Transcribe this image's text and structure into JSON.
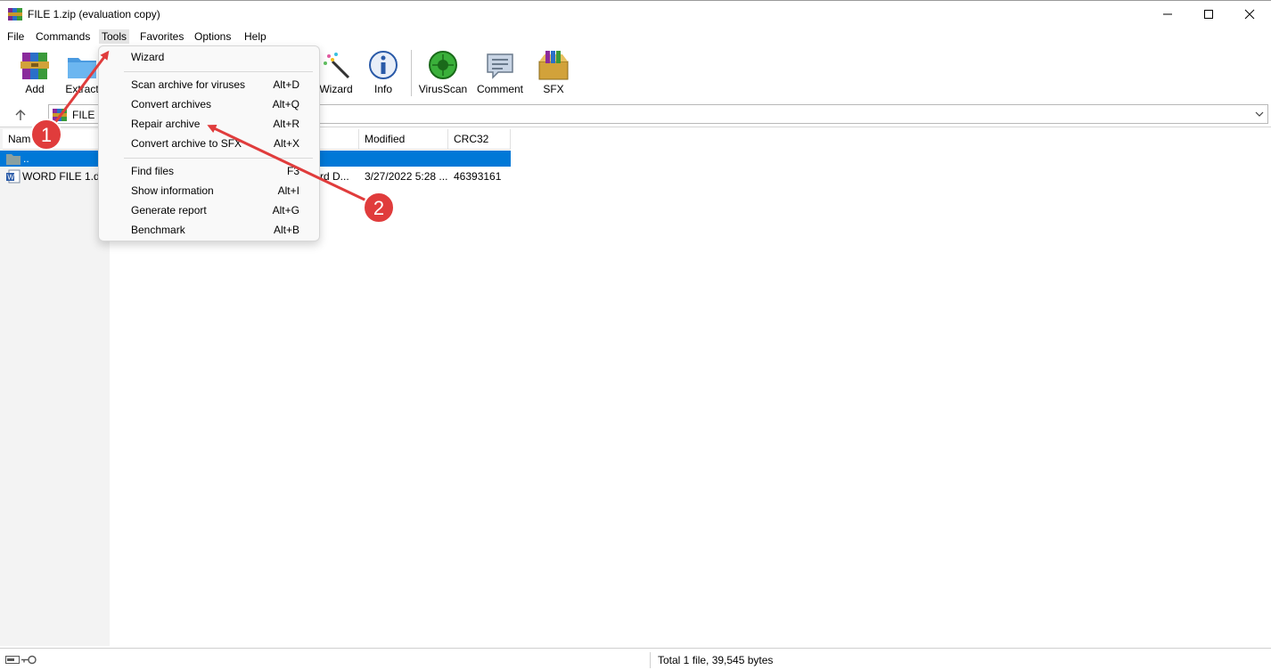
{
  "window": {
    "title": "FILE 1.zip (evaluation copy)",
    "controls": [
      "minimize",
      "maximize",
      "close"
    ]
  },
  "menubar": {
    "file": "File",
    "commands": "Commands",
    "tools": "Tools",
    "favorites": "Favorites",
    "options": "Options",
    "help": "Help"
  },
  "toolbar": {
    "add": "Add",
    "extract": "Extract",
    "wizard": "Wizard",
    "info": "Info",
    "virusscan": "VirusScan",
    "comment": "Comment",
    "sfx": "SFX"
  },
  "address": {
    "path": "FILE 1"
  },
  "columns": {
    "name": "Nam",
    "modified": "Modified",
    "crc32": "CRC32"
  },
  "rows": [
    {
      "name": "..",
      "type": "",
      "modified": "",
      "crc": ""
    },
    {
      "name": "WORD FILE 1.do",
      "type": "rd D...",
      "modified": "3/27/2022 5:28 ...",
      "crc": "46393161"
    }
  ],
  "tools_menu": {
    "items": [
      {
        "label": "Wizard",
        "shortcut": ""
      },
      {
        "label": "Scan archive for viruses",
        "shortcut": "Alt+D"
      },
      {
        "label": "Convert archives",
        "shortcut": "Alt+Q"
      },
      {
        "label": "Repair archive",
        "shortcut": "Alt+R"
      },
      {
        "label": "Convert archive to SFX",
        "shortcut": "Alt+X"
      },
      {
        "label": "Find files",
        "shortcut": "F3"
      },
      {
        "label": "Show information",
        "shortcut": "Alt+I"
      },
      {
        "label": "Generate report",
        "shortcut": "Alt+G"
      },
      {
        "label": "Benchmark",
        "shortcut": "Alt+B"
      }
    ]
  },
  "status": {
    "text": "Total 1 file, 39,545 bytes"
  },
  "annotations": {
    "step1": "1",
    "step2": "2",
    "color": "#e03c3c"
  }
}
